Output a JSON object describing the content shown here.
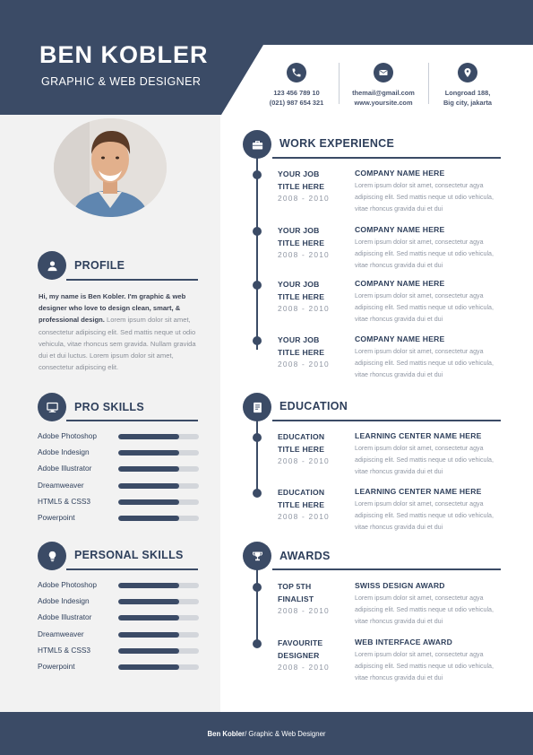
{
  "header": {
    "name": "BEN KOBLER",
    "title": "GRAPHIC & WEB DESIGNER"
  },
  "contacts": [
    {
      "icon": "phone-icon",
      "line1": "123 456 789 10",
      "line2": "(021) 987 654 321"
    },
    {
      "icon": "email-icon",
      "line1": "themail@gmail.com",
      "line2": "www.yoursite.com"
    },
    {
      "icon": "location-pin-icon",
      "line1": "Longroad 188,",
      "line2": "Big city, jakarta"
    }
  ],
  "profile": {
    "title": "PROFILE",
    "intro": "Hi, my name is Ben Kobler. I'm graphic & web designer who love to design clean, smart, & professional design.",
    "body": "Lorem ipsum dolor sit amet, consectetur adipiscing elit. Sed mattis neque ut odio vehicula, vitae rhoncus sem gravida. Nullam gravida dui et dui luctus. Lorem ipsum dolor sit amet, consectetur adipiscing elit."
  },
  "pro_skills": {
    "title": "PRO SKILLS",
    "items": [
      {
        "name": "Adobe Photoshop",
        "level": 0.75
      },
      {
        "name": "Adobe Indesign",
        "level": 0.75
      },
      {
        "name": "Adobe Illustrator",
        "level": 0.75
      },
      {
        "name": "Dreamweaver",
        "level": 0.75
      },
      {
        "name": "HTML5 & CSS3",
        "level": 0.75
      },
      {
        "name": "Powerpoint",
        "level": 0.75
      }
    ]
  },
  "personal_skills": {
    "title": "PERSONAL SKILLS",
    "items": [
      {
        "name": "Adobe Photoshop",
        "level": 0.75
      },
      {
        "name": "Adobe Indesign",
        "level": 0.75
      },
      {
        "name": "Adobe Illustrator",
        "level": 0.75
      },
      {
        "name": "Dreamweaver",
        "level": 0.75
      },
      {
        "name": "HTML5 & CSS3",
        "level": 0.75
      },
      {
        "name": "Powerpoint",
        "level": 0.75
      }
    ]
  },
  "work": {
    "title": "WORK EXPERIENCE",
    "entries": [
      {
        "role1": "YOUR JOB",
        "role2": "TITLE HERE",
        "date": "2008 - 2010",
        "head": "COMPANY NAME HERE",
        "desc": "Lorem ipsum dolor sit amet, consectetur  agya adipiscing elit. Sed mattis neque ut odio vehicula, vitae rhoncus gravida dui et dui"
      },
      {
        "role1": "YOUR JOB",
        "role2": "TITLE HERE",
        "date": "2008 - 2010",
        "head": "COMPANY NAME HERE",
        "desc": "Lorem ipsum dolor sit amet, consectetur  agya adipiscing elit. Sed mattis neque ut odio vehicula, vitae rhoncus gravida dui et dui"
      },
      {
        "role1": "YOUR JOB",
        "role2": "TITLE HERE",
        "date": "2008 - 2010",
        "head": "COMPANY NAME HERE",
        "desc": "Lorem ipsum dolor sit amet, consectetur  agya adipiscing elit. Sed mattis neque ut odio vehicula, vitae rhoncus gravida dui et dui"
      },
      {
        "role1": "YOUR JOB",
        "role2": "TITLE HERE",
        "date": "2008 - 2010",
        "head": "COMPANY NAME HERE",
        "desc": "Lorem ipsum dolor sit amet, consectetur  agya adipiscing elit. Sed mattis neque ut odio vehicula, vitae rhoncus gravida dui et dui"
      }
    ]
  },
  "education": {
    "title": "EDUCATION",
    "entries": [
      {
        "role1": "EDUCATION",
        "role2": "TITLE HERE",
        "date": "2008 - 2010",
        "head": "LEARNING CENTER NAME HERE",
        "desc": "Lorem ipsum dolor sit amet, consectetur  agya adipiscing elit. Sed mattis neque ut odio vehicula, vitae rhoncus gravida dui et dui"
      },
      {
        "role1": "EDUCATION",
        "role2": "TITLE HERE",
        "date": "2008 - 2010",
        "head": "LEARNING CENTER NAME HERE",
        "desc": "Lorem ipsum dolor sit amet, consectetur  agya adipiscing elit. Sed mattis neque ut odio vehicula, vitae rhoncus gravida dui et dui"
      }
    ]
  },
  "awards": {
    "title": "AWARDS",
    "entries": [
      {
        "role1": "TOP 5TH",
        "role2": "FINALIST",
        "date": "2008 - 2010",
        "head": "SWISS DESIGN AWARD",
        "desc": "Lorem ipsum dolor sit amet, consectetur  agya adipiscing elit. Sed mattis neque ut odio vehicula, vitae rhoncus gravida dui et dui"
      },
      {
        "role1": "FAVOURITE",
        "role2": "DESIGNER",
        "date": "2008 - 2010",
        "head": "WEB INTERFACE AWARD",
        "desc": "Lorem ipsum dolor sit amet, consectetur  agya adipiscing elit. Sed mattis neque ut odio vehicula, vitae rhoncus gravida dui et dui"
      }
    ]
  },
  "footer": {
    "name": "Ben Kobler",
    "rest": " / Graphic & Web Designer"
  },
  "colors": {
    "primary": "#3b4b66",
    "panel": "#f2f2f2",
    "muted_text": "#8f96a3"
  }
}
